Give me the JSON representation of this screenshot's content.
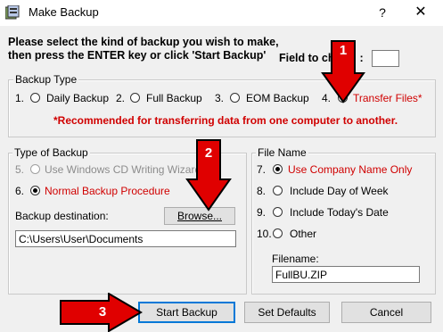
{
  "window": {
    "title": "Make Backup",
    "help_label": "?",
    "close_label": "✕"
  },
  "instructions": "Please select the kind of backup you wish to make,\nthen press the ENTER key or click 'Start Backup'",
  "field_to_change": {
    "label_visible": "Field to ch",
    "label_tail": ":",
    "value": ""
  },
  "backup_type": {
    "title": "Backup Type",
    "options": [
      {
        "num": "1.",
        "label": "Daily Backup",
        "selected": false
      },
      {
        "num": "2.",
        "label": "Full Backup",
        "selected": false
      },
      {
        "num": "3.",
        "label": "EOM Backup",
        "selected": false
      },
      {
        "num": "4.",
        "label": "Transfer Files*",
        "selected": true
      }
    ],
    "note": "*Recommended for transferring data from one computer to another."
  },
  "type_of_backup": {
    "title": "Type of Backup",
    "options": [
      {
        "num": "5.",
        "label": "Use Windows CD Writing Wizard",
        "selected": false,
        "disabled": true
      },
      {
        "num": "6.",
        "label": "Normal Backup Procedure",
        "selected": true,
        "disabled": false
      }
    ],
    "destination_label": "Backup destination:",
    "browse_label": "Browse...",
    "destination_value": "C:\\Users\\User\\Documents"
  },
  "file_name": {
    "title": "File Name",
    "options": [
      {
        "num": "7.",
        "label": "Use Company Name Only",
        "selected": true
      },
      {
        "num": "8.",
        "label": "Include Day of Week",
        "selected": false
      },
      {
        "num": "9.",
        "label": "Include Today's Date",
        "selected": false
      },
      {
        "num": "10.",
        "label": "Other",
        "selected": false
      }
    ],
    "filename_label": "Filename:",
    "filename_value": "FullBU.ZIP"
  },
  "buttons": {
    "start": "Start Backup",
    "defaults": "Set Defaults",
    "cancel": "Cancel"
  },
  "callouts": [
    "1",
    "2",
    "3"
  ],
  "colors": {
    "accent_red": "#d00000",
    "arrow_red": "#e00000",
    "focus_blue": "#0078d7"
  }
}
